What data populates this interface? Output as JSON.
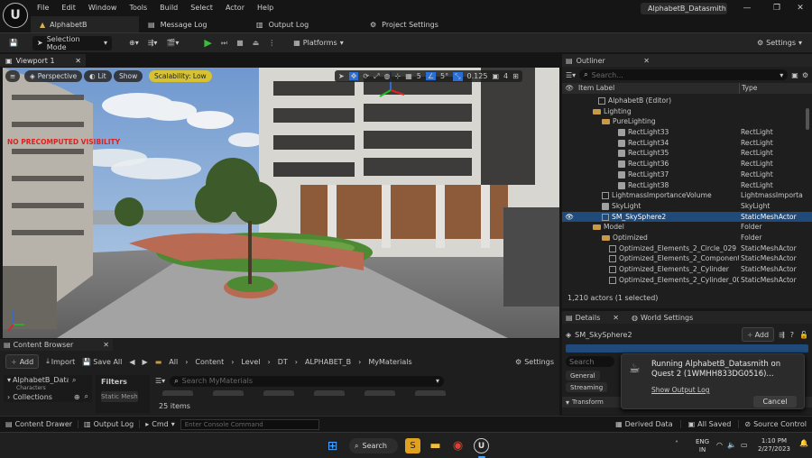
{
  "menu": [
    "File",
    "Edit",
    "Window",
    "Tools",
    "Build",
    "Select",
    "Actor",
    "Help"
  ],
  "project_title": "AlphabetB_Datasmith",
  "tabs": [
    {
      "label": "AlphabetB",
      "active": true
    },
    {
      "label": "Message Log",
      "active": false
    },
    {
      "label": "Output Log",
      "active": false
    },
    {
      "label": "Project Settings",
      "active": false
    }
  ],
  "toolbar": {
    "selection_mode": "Selection Mode",
    "platforms": "Platforms",
    "settings": "Settings"
  },
  "viewport": {
    "tab_label": "Viewport 1",
    "perspective": "Perspective",
    "lit": "Lit",
    "show": "Show",
    "scalability": "Scalability: Low",
    "grid_snap": "5",
    "angle_snap": "5°",
    "scale_snap": "0.125",
    "camera_speed": "4",
    "warning": "NO PRECOMPUTED VISIBILITY"
  },
  "outliner": {
    "title": "Outliner",
    "search_placeholder": "Search...",
    "col_label": "Item Label",
    "col_type": "Type",
    "rows": [
      {
        "label": "AlphabetB (Editor)",
        "type": "",
        "indent": 40,
        "icon": "mesh"
      },
      {
        "label": "Lighting",
        "type": "",
        "indent": 34,
        "icon": "fold"
      },
      {
        "label": "PureLighting",
        "type": "",
        "indent": 44,
        "icon": "fold"
      },
      {
        "label": "RectLight33",
        "type": "RectLight",
        "indent": 62,
        "icon": "light"
      },
      {
        "label": "RectLight34",
        "type": "RectLight",
        "indent": 62,
        "icon": "light"
      },
      {
        "label": "RectLight35",
        "type": "RectLight",
        "indent": 62,
        "icon": "light"
      },
      {
        "label": "RectLight36",
        "type": "RectLight",
        "indent": 62,
        "icon": "light"
      },
      {
        "label": "RectLight37",
        "type": "RectLight",
        "indent": 62,
        "icon": "light"
      },
      {
        "label": "RectLight38",
        "type": "RectLight",
        "indent": 62,
        "icon": "light"
      },
      {
        "label": "LightmassImportanceVolume",
        "type": "LightmassImporta",
        "indent": 44,
        "icon": "mesh"
      },
      {
        "label": "SkyLight",
        "type": "SkyLight",
        "indent": 44,
        "icon": "light"
      },
      {
        "label": "SM_SkySphere2",
        "type": "StaticMeshActor",
        "indent": 44,
        "icon": "mesh",
        "selected": true
      },
      {
        "label": "Model",
        "type": "Folder",
        "indent": 34,
        "icon": "fold"
      },
      {
        "label": "Optimized",
        "type": "Folder",
        "indent": 44,
        "icon": "fold"
      },
      {
        "label": "Optimized_Elements_2_Circle_029",
        "type": "StaticMeshActor",
        "indent": 52,
        "icon": "mesh"
      },
      {
        "label": "Optimized_Elements_2_Component_",
        "type": "StaticMeshActor",
        "indent": 52,
        "icon": "mesh"
      },
      {
        "label": "Optimized_Elements_2_Cylinder",
        "type": "StaticMeshActor",
        "indent": 52,
        "icon": "mesh"
      },
      {
        "label": "Optimized_Elements_2_Cylinder_001",
        "type": "StaticMeshActor",
        "indent": 52,
        "icon": "mesh"
      }
    ],
    "count": "1,210 actors (1 selected)"
  },
  "details": {
    "tab_details": "Details",
    "tab_world": "World Settings",
    "actor_name": "SM_SkySphere2",
    "add_label": "Add",
    "search_placeholder": "Search",
    "filter_general": "General",
    "filter_streaming": "Streaming",
    "section_transform": "Transform"
  },
  "notification": {
    "line1": "Running AlphabetB_Datasmith on",
    "line2": "Quest 2 (1WMHH833DG0516)...",
    "link": "Show Output Log",
    "cancel": "Cancel"
  },
  "content_browser": {
    "title": "Content Browser",
    "add": "Add",
    "import": "Import",
    "save_all": "Save All",
    "path": [
      "All",
      "Content",
      "Level",
      "DT",
      "ALPHABET_B",
      "MyMaterials"
    ],
    "settings": "Settings",
    "tree_root": "AlphabetB_Datas",
    "tree_child": "Characters",
    "collections": "Collections",
    "filters": "Filters",
    "filter_chip": "Static Mesh",
    "search_placeholder": "Search MyMaterials",
    "items": "25 items"
  },
  "statusbar": {
    "content_drawer": "Content Drawer",
    "output_log": "Output Log",
    "cmd": "Cmd",
    "console_placeholder": "Enter Console Command",
    "derived_data": "Derived Data",
    "all_saved": "All Saved",
    "source_control": "Source Control"
  },
  "taskbar": {
    "search": "Search",
    "lang1": "ENG",
    "lang2": "IN",
    "time": "1:10 PM",
    "date": "2/27/2023"
  },
  "colors": {
    "accent": "#2a6fd6",
    "selection": "#1f4a7a",
    "scalability_bg": "#d6c233",
    "play_green": "#3bbd3b"
  }
}
